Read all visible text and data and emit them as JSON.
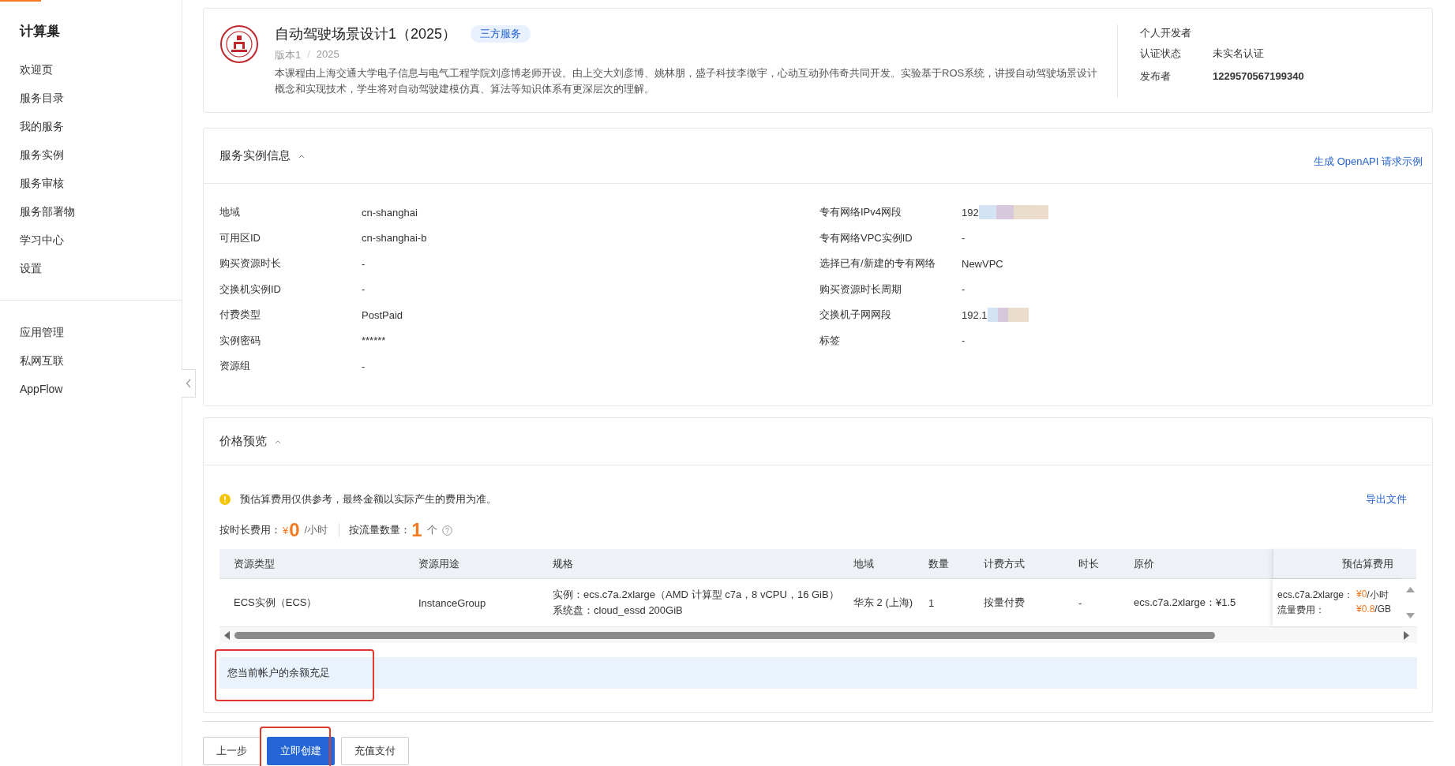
{
  "sidebar": {
    "title": "计算巢",
    "groups": [
      [
        "欢迎页",
        "服务目录",
        "我的服务",
        "服务实例",
        "服务审核",
        "服务部署物",
        "学习中心",
        "设置"
      ],
      [
        "应用管理",
        "私网互联",
        "AppFlow"
      ]
    ]
  },
  "service": {
    "title": "自动驾驶场景设计1（2025）",
    "tag": "三方服务",
    "version": "版本1",
    "version_separator": "/",
    "year": "2025",
    "description": "本课程由上海交通大学电子信息与电气工程学院刘彦博老师开设。由上交大刘彦博、姚林朋，盛子科技李徵宇，心动互动孙伟奇共同开发。实验基于ROS系统，讲授自动驾驶场景设计概念和实现技术，学生将对自动驾驶建模仿真、算法等知识体系有更深层次的理解。",
    "publisher_type": "个人开发者",
    "fields": [
      {
        "label": "认证状态",
        "value": "未实名认证",
        "bold": false
      },
      {
        "label": "发布者",
        "value": "1229570567199340",
        "bold": true
      }
    ]
  },
  "instance_info": {
    "title": "服务实例信息",
    "link": "生成 OpenAPI 请求示例",
    "left": [
      {
        "label": "地域",
        "value": "cn-shanghai",
        "redacted": false
      },
      {
        "label": "可用区ID",
        "value": "cn-shanghai-b",
        "redacted": false
      },
      {
        "label": "购买资源时长",
        "value": "-",
        "redacted": false
      },
      {
        "label": "交换机实例ID",
        "value": "-",
        "redacted": false
      },
      {
        "label": "付费类型",
        "value": "PostPaid",
        "redacted": false
      },
      {
        "label": "实例密码",
        "value": "******",
        "redacted": false
      },
      {
        "label": "资源组",
        "value": "-",
        "redacted": false
      }
    ],
    "right": [
      {
        "label": "专有网络IPv4网段",
        "value": "192",
        "redacted": true
      },
      {
        "label": "专有网络VPC实例ID",
        "value": "-",
        "redacted": false
      },
      {
        "label": "选择已有/新建的专有网络",
        "value": "NewVPC",
        "redacted": false
      },
      {
        "label": "购买资源时长周期",
        "value": "-",
        "redacted": false
      },
      {
        "label": "交换机子网网段",
        "value": "192.1",
        "redacted": true
      },
      {
        "label": "标签",
        "value": "-",
        "redacted": false
      }
    ]
  },
  "price_preview": {
    "title": "价格预览",
    "notice": "预估算费用仅供参考，最终金额以实际产生的费用为准。",
    "export_link": "导出文件",
    "hourly_label": "按时长费用：",
    "hourly_currency": "¥",
    "hourly_amount": "0",
    "hourly_unit": "/小时",
    "traffic_label": "按流量数量：",
    "traffic_count": "1",
    "traffic_unit": "个",
    "table": {
      "columns": [
        "资源类型",
        "资源用途",
        "规格",
        "地域",
        "数量",
        "计费方式",
        "时长",
        "原价",
        "预估算费用"
      ],
      "rows": [
        {
          "cells": [
            "ECS实例（ECS）",
            "InstanceGroup",
            [
              "实例：ecs.c7a.2xlarge（AMD 计算型 c7a，8 vCPU，16 GiB）",
              "系统盘：cloud_essd 200GiB"
            ],
            "华东 2 (上海)",
            "1",
            "按量付费",
            "-",
            "ecs.c7a.2xlarge：¥1.5"
          ],
          "estimate": [
            {
              "label": "ecs.c7a.2xlarge：",
              "price": "¥0",
              "unit": "/小时"
            },
            {
              "label": "流量费用：",
              "price": "¥0.8",
              "unit": "/GB"
            }
          ]
        }
      ]
    },
    "balance": {
      "text": "您当前帐户的余额充足",
      "highlighted": true
    }
  },
  "buttons": [
    {
      "label": "上一步",
      "kind": "default",
      "highlighted": false
    },
    {
      "label": "立即创建",
      "kind": "primary",
      "highlighted": true
    },
    {
      "label": "充值支付",
      "kind": "default",
      "highlighted": false
    }
  ]
}
